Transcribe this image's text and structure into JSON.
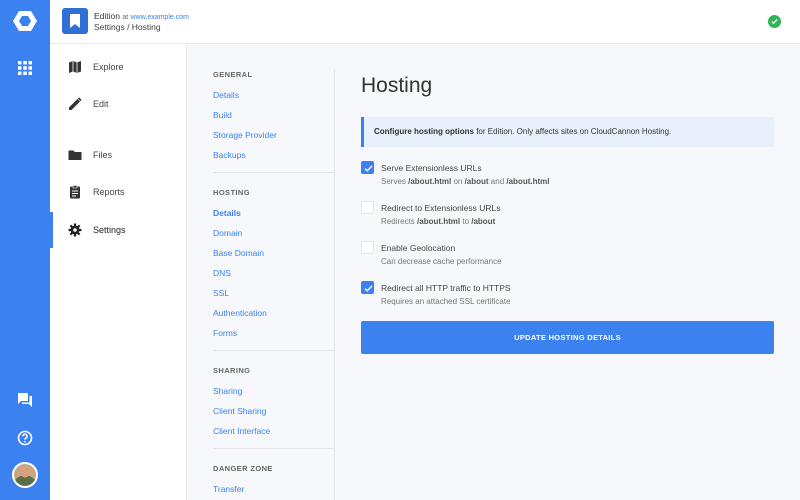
{
  "app": {
    "site_name": "Edition",
    "site_at": "at",
    "site_url": "www.example.com",
    "breadcrumb": "Settings / Hosting"
  },
  "rail": {
    "icons": [
      "cloudcannon-logo-icon",
      "apps-grid-icon",
      "chat-icon",
      "help-icon",
      "avatar"
    ]
  },
  "nav": {
    "items": [
      {
        "label": "Explore",
        "icon": "map-icon"
      },
      {
        "label": "Edit",
        "icon": "pencil-icon"
      },
      {
        "label": "Files",
        "icon": "folder-icon"
      },
      {
        "label": "Reports",
        "icon": "clipboard-icon"
      },
      {
        "label": "Settings",
        "icon": "gear-icon",
        "active": true
      }
    ]
  },
  "subnav": {
    "general": {
      "title": "GENERAL",
      "links": [
        "Details",
        "Build",
        "Storage Provider",
        "Backups"
      ]
    },
    "hosting": {
      "title": "HOSTING",
      "links": [
        "Details",
        "Domain",
        "Base Domain",
        "DNS",
        "SSL",
        "Authentication",
        "Forms"
      ],
      "current": "Details"
    },
    "sharing": {
      "title": "SHARING",
      "links": [
        "Sharing",
        "Client Sharing",
        "Client Interface"
      ]
    },
    "danger": {
      "title": "DANGER ZONE",
      "links": [
        "Transfer"
      ]
    }
  },
  "main": {
    "title": "Hosting",
    "notice": {
      "strong": "Configure hosting options",
      "rest": " for Edition. Only affects sites on CloudCannon Hosting."
    },
    "options": [
      {
        "title": "Serve Extensionless URLs",
        "checked": true,
        "hint_parts": [
          "Serves ",
          "/about.html",
          " on ",
          "/about",
          " and ",
          "/about.html"
        ]
      },
      {
        "title": "Redirect to Extensionless URLs",
        "checked": false,
        "hint_parts": [
          "Redirects ",
          "/about.html",
          " to ",
          "/about",
          "",
          ""
        ]
      },
      {
        "title": "Enable Geolocation",
        "checked": false,
        "hint_parts": [
          "Can decrease cache performance",
          "",
          "",
          "",
          "",
          ""
        ]
      },
      {
        "title": "Redirect all HTTP traffic to HTTPS",
        "checked": true,
        "hint_parts": [
          "Requires an attached SSL certificate",
          "",
          "",
          "",
          "",
          ""
        ]
      }
    ],
    "update_button": "UPDATE HOSTING DETAILS"
  },
  "colors": {
    "accent": "#3b82f0",
    "success": "#2fb45a",
    "notice_bg": "#e8f0fc"
  }
}
